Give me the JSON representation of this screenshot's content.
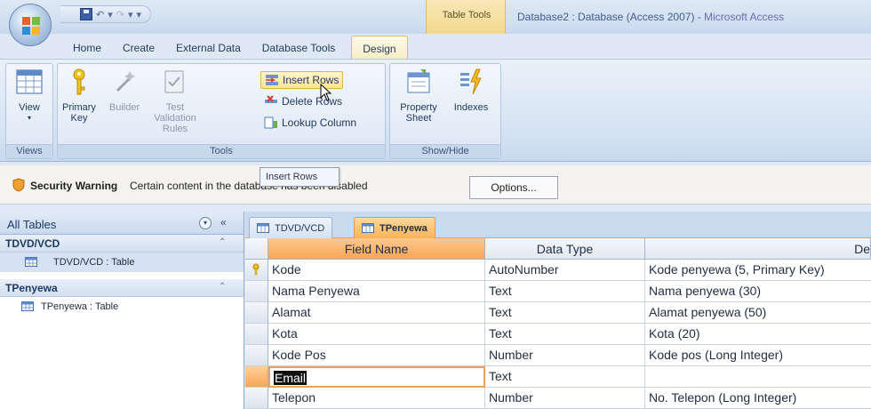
{
  "window": {
    "title": "Database2 : Database (Access 2007) - ",
    "app_name": "Microsoft Access",
    "context_tab_header": "Table Tools"
  },
  "quick_access": {
    "separator": "▾"
  },
  "ribbon_tabs": [
    {
      "label": "Home"
    },
    {
      "label": "Create"
    },
    {
      "label": "External Data"
    },
    {
      "label": "Database Tools"
    },
    {
      "label": "Design"
    }
  ],
  "ribbon": {
    "views": {
      "label": "Views",
      "view_btn": "View"
    },
    "tools": {
      "label": "Tools",
      "primary_key": "Primary Key",
      "builder": "Builder",
      "test_validation": "Test Validation Rules",
      "insert_rows": "Insert Rows",
      "delete_rows": "Delete Rows",
      "lookup_column": "Lookup Column"
    },
    "show_hide": {
      "label": "Show/Hide",
      "property_sheet": "Property Sheet",
      "indexes": "Indexes"
    }
  },
  "tooltip": {
    "text": "Insert Rows"
  },
  "security_bar": {
    "title": "Security Warning",
    "message": "Certain content in the database has been disabled",
    "options_btn": "Options..."
  },
  "nav_pane": {
    "header": "All Tables",
    "groups": [
      {
        "label": "TDVD/VCD",
        "item": "TDVD/VCD : Table"
      },
      {
        "label": "TPenyewa",
        "item": "TPenyewa : Table"
      }
    ]
  },
  "doc_tabs": [
    {
      "label": "TDVD/VCD"
    },
    {
      "label": "TPenyewa"
    }
  ],
  "grid": {
    "headers": {
      "field_name": "Field Name",
      "data_type": "Data Type",
      "description": "De"
    },
    "rows": [
      {
        "field": "Kode",
        "type": "AutoNumber",
        "desc": "Kode penyewa (5, Primary Key)"
      },
      {
        "field": "Nama Penyewa",
        "type": "Text",
        "desc": "Nama penyewa (30)"
      },
      {
        "field": "Alamat",
        "type": "Text",
        "desc": "Alamat penyewa (50)"
      },
      {
        "field": "Kota",
        "type": "Text",
        "desc": "Kota (20)"
      },
      {
        "field": "Kode Pos",
        "type": "Number",
        "desc": "Kode pos (Long Integer)"
      },
      {
        "field": "Email",
        "type": "Text",
        "desc": ""
      },
      {
        "field": "Telepon",
        "type": "Number",
        "desc": "No. Telepon (Long Integer)"
      }
    ]
  },
  "colors": {
    "accent_orange": "#f6a557",
    "ribbon_blue": "#d6e3f3",
    "context_yellow": "#f3d98d"
  }
}
